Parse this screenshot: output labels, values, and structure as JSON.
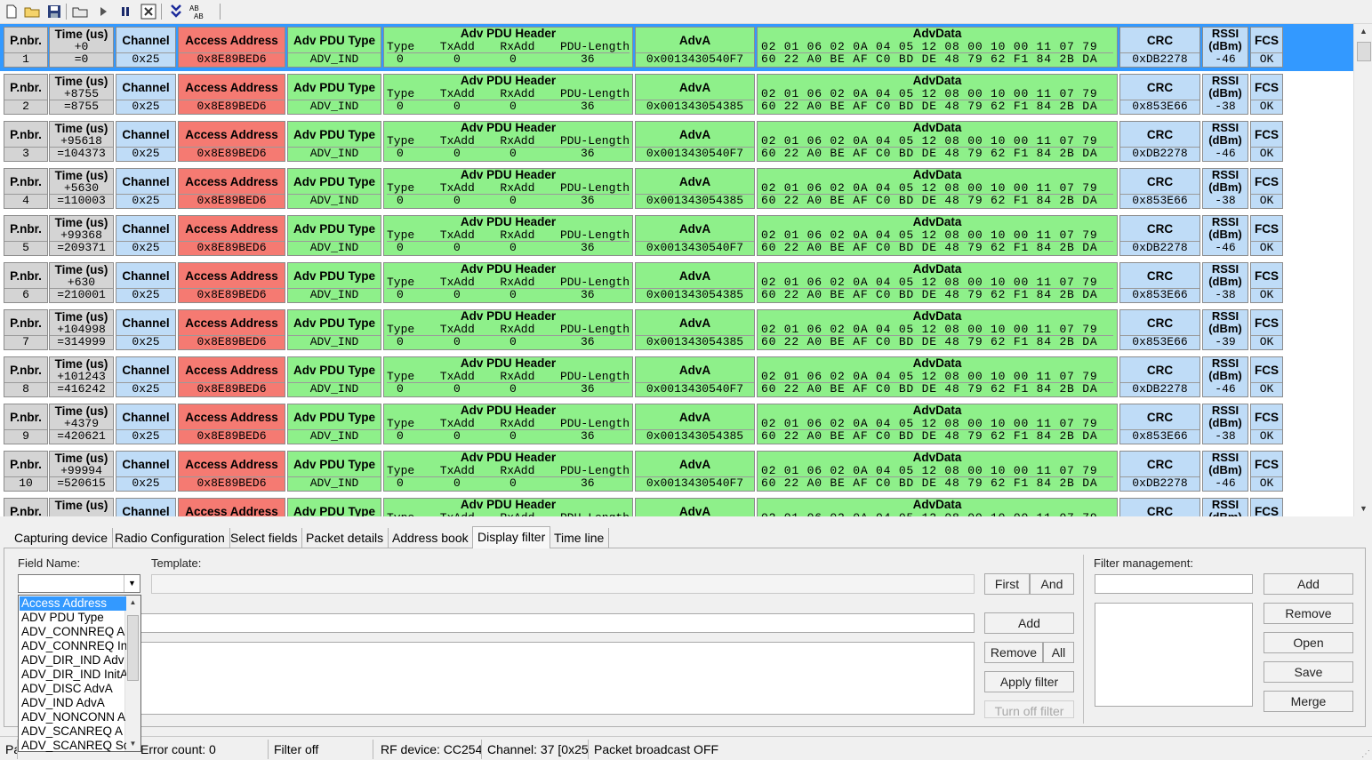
{
  "toolbar": {
    "icons": [
      "new-file-icon",
      "open-folder-icon",
      "save-icon",
      "open-capture-icon",
      "play-icon",
      "pause-icon",
      "clear-icon",
      "autoscroll-icon",
      "select-fields-icon"
    ]
  },
  "columns": {
    "pnbr": "P.nbr.",
    "time": "Time (us)",
    "channel": "Channel",
    "access_address": "Access Address",
    "adv_pdu_type": "Adv PDU Type",
    "adv_pdu_header": "Adv PDU Header",
    "header_fields": [
      "Type",
      "TxAdd",
      "RxAdd",
      "PDU-Length"
    ],
    "adva": "AdvA",
    "advdata": "AdvData",
    "crc": "CRC",
    "rssi_line1": "RSSI",
    "rssi_line2": "(dBm)",
    "fcs": "FCS"
  },
  "packets": [
    {
      "nbr": "1",
      "delta": "+0",
      "abs": "=0",
      "channel": "0x25",
      "aa": "0x8E89BED6",
      "pdu_type": "ADV_IND",
      "h_type": "0",
      "h_tx": "0",
      "h_rx": "0",
      "h_len": "36",
      "adva": "0x0013430540F7",
      "data1": "02 01 06 02 0A 04 05 12 08 00 10 00 11 07 79",
      "data2": "60 22 A0 BE AF C0 BD DE 48 79 62 F1 84 2B DA",
      "crc": "0xDB2278",
      "rssi": "-46",
      "fcs": "OK"
    },
    {
      "nbr": "2",
      "delta": "+8755",
      "abs": "=8755",
      "channel": "0x25",
      "aa": "0x8E89BED6",
      "pdu_type": "ADV_IND",
      "h_type": "0",
      "h_tx": "0",
      "h_rx": "0",
      "h_len": "36",
      "adva": "0x001343054385",
      "data1": "02 01 06 02 0A 04 05 12 08 00 10 00 11 07 79",
      "data2": "60 22 A0 BE AF C0 BD DE 48 79 62 F1 84 2B DA",
      "crc": "0x853E66",
      "rssi": "-38",
      "fcs": "OK"
    },
    {
      "nbr": "3",
      "delta": "+95618",
      "abs": "=104373",
      "channel": "0x25",
      "aa": "0x8E89BED6",
      "pdu_type": "ADV_IND",
      "h_type": "0",
      "h_tx": "0",
      "h_rx": "0",
      "h_len": "36",
      "adva": "0x0013430540F7",
      "data1": "02 01 06 02 0A 04 05 12 08 00 10 00 11 07 79",
      "data2": "60 22 A0 BE AF C0 BD DE 48 79 62 F1 84 2B DA",
      "crc": "0xDB2278",
      "rssi": "-46",
      "fcs": "OK"
    },
    {
      "nbr": "4",
      "delta": "+5630",
      "abs": "=110003",
      "channel": "0x25",
      "aa": "0x8E89BED6",
      "pdu_type": "ADV_IND",
      "h_type": "0",
      "h_tx": "0",
      "h_rx": "0",
      "h_len": "36",
      "adva": "0x001343054385",
      "data1": "02 01 06 02 0A 04 05 12 08 00 10 00 11 07 79",
      "data2": "60 22 A0 BE AF C0 BD DE 48 79 62 F1 84 2B DA",
      "crc": "0x853E66",
      "rssi": "-38",
      "fcs": "OK"
    },
    {
      "nbr": "5",
      "delta": "+99368",
      "abs": "=209371",
      "channel": "0x25",
      "aa": "0x8E89BED6",
      "pdu_type": "ADV_IND",
      "h_type": "0",
      "h_tx": "0",
      "h_rx": "0",
      "h_len": "36",
      "adva": "0x0013430540F7",
      "data1": "02 01 06 02 0A 04 05 12 08 00 10 00 11 07 79",
      "data2": "60 22 A0 BE AF C0 BD DE 48 79 62 F1 84 2B DA",
      "crc": "0xDB2278",
      "rssi": "-46",
      "fcs": "OK"
    },
    {
      "nbr": "6",
      "delta": "+630",
      "abs": "=210001",
      "channel": "0x25",
      "aa": "0x8E89BED6",
      "pdu_type": "ADV_IND",
      "h_type": "0",
      "h_tx": "0",
      "h_rx": "0",
      "h_len": "36",
      "adva": "0x001343054385",
      "data1": "02 01 06 02 0A 04 05 12 08 00 10 00 11 07 79",
      "data2": "60 22 A0 BE AF C0 BD DE 48 79 62 F1 84 2B DA",
      "crc": "0x853E66",
      "rssi": "-38",
      "fcs": "OK"
    },
    {
      "nbr": "7",
      "delta": "+104998",
      "abs": "=314999",
      "channel": "0x25",
      "aa": "0x8E89BED6",
      "pdu_type": "ADV_IND",
      "h_type": "0",
      "h_tx": "0",
      "h_rx": "0",
      "h_len": "36",
      "adva": "0x001343054385",
      "data1": "02 01 06 02 0A 04 05 12 08 00 10 00 11 07 79",
      "data2": "60 22 A0 BE AF C0 BD DE 48 79 62 F1 84 2B DA",
      "crc": "0x853E66",
      "rssi": "-39",
      "fcs": "OK"
    },
    {
      "nbr": "8",
      "delta": "+101243",
      "abs": "=416242",
      "channel": "0x25",
      "aa": "0x8E89BED6",
      "pdu_type": "ADV_IND",
      "h_type": "0",
      "h_tx": "0",
      "h_rx": "0",
      "h_len": "36",
      "adva": "0x0013430540F7",
      "data1": "02 01 06 02 0A 04 05 12 08 00 10 00 11 07 79",
      "data2": "60 22 A0 BE AF C0 BD DE 48 79 62 F1 84 2B DA",
      "crc": "0xDB2278",
      "rssi": "-46",
      "fcs": "OK"
    },
    {
      "nbr": "9",
      "delta": "+4379",
      "abs": "=420621",
      "channel": "0x25",
      "aa": "0x8E89BED6",
      "pdu_type": "ADV_IND",
      "h_type": "0",
      "h_tx": "0",
      "h_rx": "0",
      "h_len": "36",
      "adva": "0x001343054385",
      "data1": "02 01 06 02 0A 04 05 12 08 00 10 00 11 07 79",
      "data2": "60 22 A0 BE AF C0 BD DE 48 79 62 F1 84 2B DA",
      "crc": "0x853E66",
      "rssi": "-38",
      "fcs": "OK"
    },
    {
      "nbr": "10",
      "delta": "+99994",
      "abs": "=520615",
      "channel": "0x25",
      "aa": "0x8E89BED6",
      "pdu_type": "ADV_IND",
      "h_type": "0",
      "h_tx": "0",
      "h_rx": "0",
      "h_len": "36",
      "adva": "0x0013430540F7",
      "data1": "02 01 06 02 0A 04 05 12 08 00 10 00 11 07 79",
      "data2": "60 22 A0 BE AF C0 BD DE 48 79 62 F1 84 2B DA",
      "crc": "0xDB2278",
      "rssi": "-46",
      "fcs": "OK"
    },
    {
      "nbr": "",
      "delta": "",
      "abs": "",
      "channel": "",
      "aa": "",
      "pdu_type": "",
      "h_type": "",
      "h_tx": "",
      "h_rx": "",
      "h_len": "",
      "adva": "",
      "data1": "02 01 06 02 0A 04 05 12 08 00 10 00 11 07 79",
      "data2": "",
      "crc": "",
      "rssi": "",
      "fcs": ""
    }
  ],
  "tabs": [
    "Capturing device",
    "Radio Configuration",
    "Select fields",
    "Packet details",
    "Address book",
    "Display filter",
    "Time line"
  ],
  "active_tab": "Display filter",
  "filter": {
    "field_name_label": "Field Name:",
    "template_label": "Template:",
    "field_name_value": "",
    "dropdown_items": [
      "Access Address",
      "ADV PDU Type",
      "ADV_CONNREQ A",
      "ADV_CONNREQ In",
      "ADV_DIR_IND Adv",
      "ADV_DIR_IND InitA",
      "ADV_DISC AdvA",
      "ADV_IND AdvA",
      "ADV_NONCONN A",
      "ADV_SCANREQ A",
      "ADV_SCANREQ Sc"
    ],
    "selected_item": "Access Address",
    "first_button": "First",
    "and_button": "And",
    "add_button": "Add",
    "remove_button": "Remove",
    "all_button": "All",
    "apply_button": "Apply filter",
    "turn_off_button": "Turn off filter"
  },
  "filter_management": {
    "label": "Filter management:",
    "add_button": "Add",
    "remove_button": "Remove",
    "open_button": "Open",
    "save_button": "Save",
    "merge_button": "Merge"
  },
  "statusbar": {
    "packets": "Pa",
    "errors": "Error count: 0",
    "filter": "Filter off",
    "rf_device": "RF device: CC254",
    "channel": "Channel: 37 [0x25",
    "broadcast": "Packet broadcast OFF"
  },
  "colors": {
    "selection": "#3399ff",
    "grey_cell": "#d4d4d4",
    "blue_cell": "#bfdcf7",
    "red_cell": "#f57a72",
    "green_cell": "#8ef08a"
  }
}
